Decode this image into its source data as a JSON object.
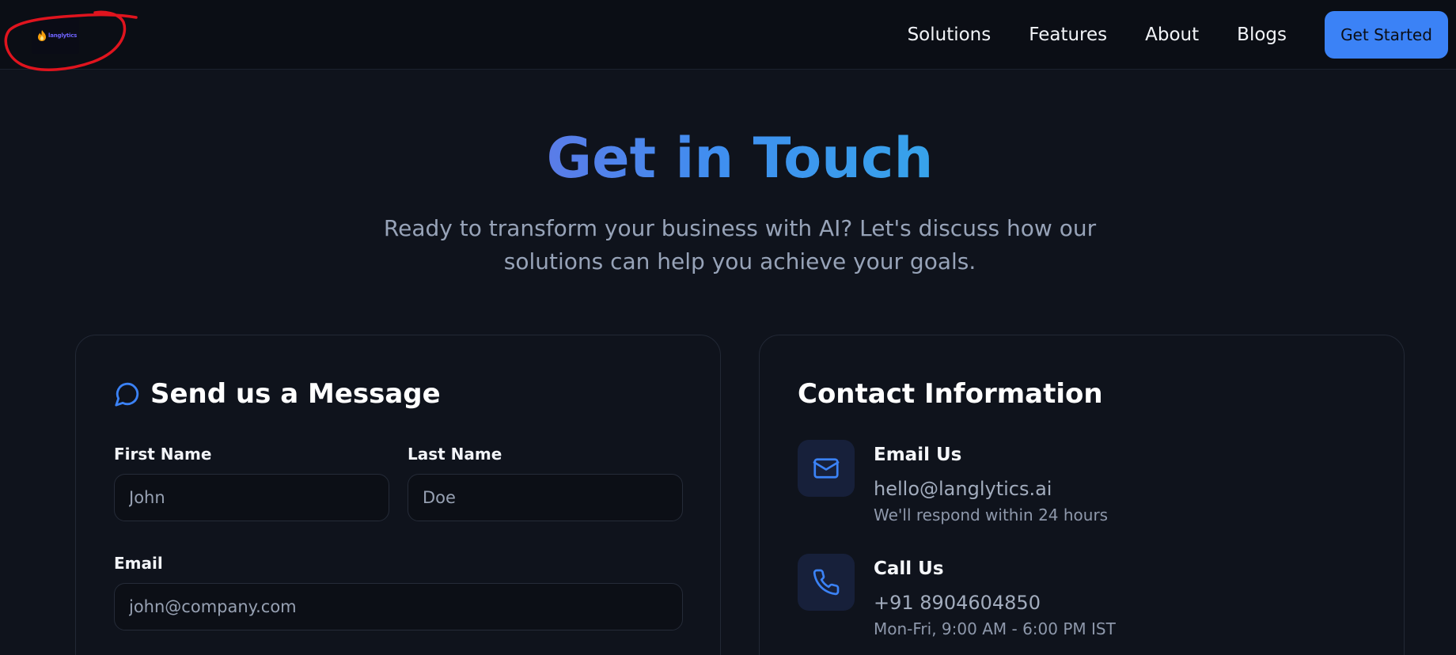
{
  "brand": {
    "logo_text": "langlytics"
  },
  "nav": {
    "links": [
      "Solutions",
      "Features",
      "About",
      "Blogs"
    ],
    "cta_label": "Get Started"
  },
  "hero": {
    "title": "Get in Touch",
    "subtitle": "Ready to transform your business with AI? Let's discuss how our solutions can help you achieve your goals."
  },
  "message_form": {
    "heading": "Send us a Message",
    "first_name": {
      "label": "First Name",
      "placeholder": "John"
    },
    "last_name": {
      "label": "Last Name",
      "placeholder": "Doe"
    },
    "email": {
      "label": "Email",
      "placeholder": "john@company.com"
    }
  },
  "contact_info": {
    "heading": "Contact Information",
    "email": {
      "title": "Email Us",
      "value": "hello@langlytics.ai",
      "note": "We'll respond within 24 hours",
      "icon": "mail-icon"
    },
    "phone": {
      "title": "Call Us",
      "value": "+91 8904604850",
      "note": "Mon-Fri, 9:00 AM - 6:00 PM IST",
      "icon": "phone-icon"
    }
  },
  "colors": {
    "accent": "#3b82f6",
    "background": "#0f131c",
    "annotation": "#e0141e"
  }
}
